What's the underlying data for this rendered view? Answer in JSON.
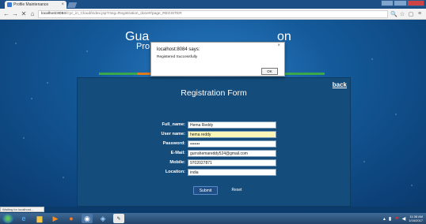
{
  "browser": {
    "tab_title": "Profile Maintenance",
    "tab_close": "×",
    "url_host": "localhost:8084",
    "url_path": "/Cyc_in_Cloud/index.jsp?msg=Registration_done#/page_REGISTER",
    "nav_back": "←",
    "nav_forward": "→",
    "nav_reload": "✕",
    "nav_home": "⌂",
    "status": "Waiting for localhost..."
  },
  "page": {
    "heading_left": "Gua",
    "heading_right": "on",
    "subheading_left": "Pro",
    "subheading_right": "e",
    "menu_colors": [
      "#3aa84a",
      "#e07b1a",
      "#3aa84a",
      "#e07b1a",
      "#3aa84a",
      "#3aa84a"
    ]
  },
  "form": {
    "title": "Registration Form",
    "back_link": "back",
    "fields": [
      {
        "label": "Full_name:",
        "value": "Hema Reddy",
        "highlight": false
      },
      {
        "label": "User name:",
        "value": "hema reddy",
        "highlight": true
      },
      {
        "label": "Password:",
        "value": "•••••••",
        "highlight": false
      },
      {
        "label": "E-Mail:",
        "value": "gurrahemareddy524@gmail.com",
        "highlight": false
      },
      {
        "label": "Mobile:",
        "value": "9702027871",
        "highlight": false
      },
      {
        "label": "Location:",
        "value": "india",
        "highlight": false
      }
    ],
    "submit_label": "Submit",
    "reset_label": "Reset"
  },
  "dialog": {
    "title": "localhost:8084 says:",
    "message": "Registered Successfully",
    "ok_label": "OK",
    "close": "×"
  },
  "taskbar": {
    "time": "11:38 AM",
    "date": "1/16/2017"
  }
}
